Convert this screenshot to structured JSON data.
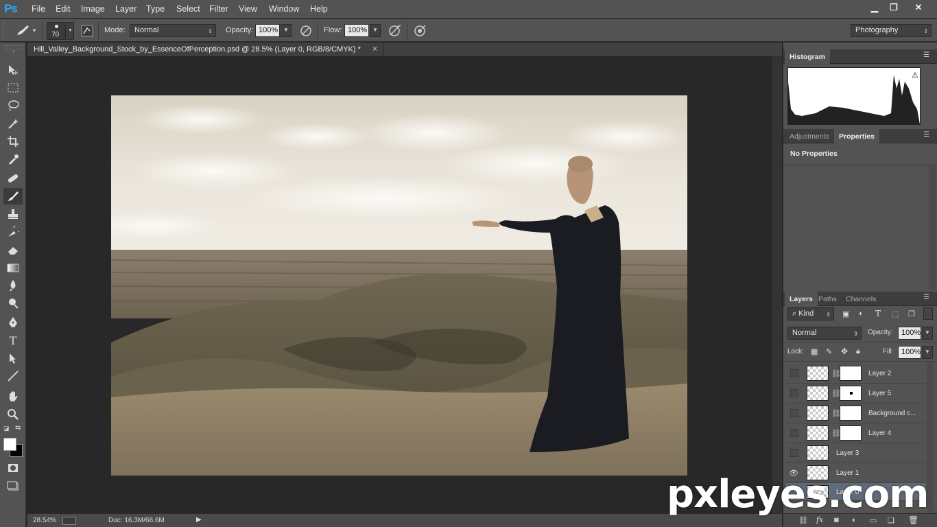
{
  "app": {
    "logo": "Ps",
    "accent": "#31a8ff"
  },
  "menu": [
    "File",
    "Edit",
    "Image",
    "Layer",
    "Type",
    "Select",
    "Filter",
    "View",
    "Window",
    "Help"
  ],
  "window_controls": {
    "minimize": "▁",
    "restore": "❐",
    "close": "✕"
  },
  "options": {
    "brush_size": "70",
    "mode_label": "Mode:",
    "mode_value": "Normal",
    "opacity_label": "Opacity:",
    "opacity_value": "100%",
    "flow_label": "Flow:",
    "flow_value": "100%",
    "workspace": "Photography"
  },
  "document": {
    "tab_title": "Hill_Valley_Background_Stock_by_EssenceOfPerception.psd @ 28.5% (Layer 0, RGB/8/CMYK) *",
    "close": "×"
  },
  "status": {
    "zoom": "28.54%",
    "doc": "Doc: 16.3M/68.6M"
  },
  "panels": {
    "histogram": {
      "tab": "Histogram"
    },
    "adjust_tabs": [
      "Adjustments",
      "Properties"
    ],
    "properties_text": "No Properties",
    "layer_tabs": [
      "Layers",
      "Paths",
      "Channels"
    ],
    "kind_filter": "Kind",
    "blend_mode": "Normal",
    "opacity_label": "Opacity:",
    "opacity_value": "100%",
    "lock_label": "Lock:",
    "fill_label": "Fill:",
    "fill_value": "100%"
  },
  "layers": [
    {
      "name": "Layer 2",
      "visible": false,
      "mask": true
    },
    {
      "name": "Layer 5",
      "visible": false,
      "mask": true
    },
    {
      "name": "Background c...",
      "visible": false,
      "mask": true
    },
    {
      "name": "Layer 4",
      "visible": false,
      "mask": true
    },
    {
      "name": "Layer 3",
      "visible": false,
      "mask": false
    },
    {
      "name": "Layer 1",
      "visible": true,
      "mask": false
    },
    {
      "name": "Layer 0",
      "visible": true,
      "mask": false
    }
  ],
  "watermark": "pxleyes.com",
  "icons": [
    "brush-icon",
    "move-icon",
    "marquee-icon",
    "lasso-icon",
    "magic-wand-icon",
    "crop-icon",
    "eyedropper-icon",
    "healing-icon",
    "brush-tool-icon",
    "stamp-icon",
    "history-brush-icon",
    "eraser-icon",
    "gradient-icon",
    "blur-icon",
    "dodge-icon",
    "pen-icon",
    "type-icon",
    "path-select-icon",
    "line-icon",
    "hand-icon",
    "zoom-icon",
    "eye-icon",
    "link-icon",
    "fx-icon",
    "mask-icon",
    "folder-icon",
    "new-layer-icon",
    "trash-icon"
  ]
}
